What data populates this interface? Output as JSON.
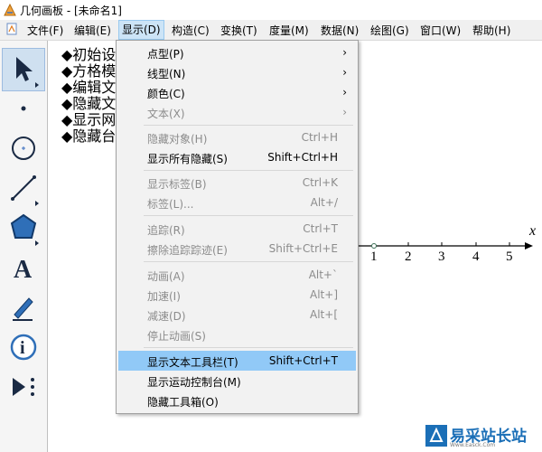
{
  "window": {
    "title": "几何画板 - [未命名1]"
  },
  "menubar": {
    "items": [
      {
        "label": "文件(F)"
      },
      {
        "label": "编辑(E)"
      },
      {
        "label": "显示(D)"
      },
      {
        "label": "构造(C)"
      },
      {
        "label": "变换(T)"
      },
      {
        "label": "度量(M)"
      },
      {
        "label": "数据(N)"
      },
      {
        "label": "绘图(G)"
      },
      {
        "label": "窗口(W)"
      },
      {
        "label": "帮助(H)"
      }
    ]
  },
  "toolbox": {
    "tools": [
      {
        "icon": "arrow-select-icon"
      },
      {
        "icon": "point-icon"
      },
      {
        "icon": "compass-circle-icon"
      },
      {
        "icon": "straightedge-icon"
      },
      {
        "icon": "polygon-icon"
      },
      {
        "icon": "text-tool-icon",
        "glyph": "A"
      },
      {
        "icon": "marker-pen-icon"
      },
      {
        "icon": "information-icon",
        "glyph": "i"
      },
      {
        "icon": "custom-tool-icon"
      }
    ]
  },
  "canvas": {
    "text_lines": [
      "◆初始设",
      "◆方格模",
      "◆编辑文",
      "◆隐藏文",
      "◆显示网",
      "◆隐藏台"
    ],
    "axis": {
      "label": "x",
      "ticks": [
        "1",
        "2",
        "3",
        "4",
        "5"
      ]
    }
  },
  "display_menu": {
    "items": [
      {
        "label": "点型(P)",
        "submenu": true
      },
      {
        "label": "线型(N)",
        "submenu": true
      },
      {
        "label": "颜色(C)",
        "submenu": true
      },
      {
        "label": "文本(X)",
        "submenu": true,
        "disabled": true
      },
      {
        "label": "隐藏对象(H)",
        "shortcut": "Ctrl+H",
        "disabled": true
      },
      {
        "label": "显示所有隐藏(S)",
        "shortcut": "Shift+Ctrl+H"
      },
      {
        "label": "显示标签(B)",
        "shortcut": "Ctrl+K",
        "disabled": true
      },
      {
        "label": "标签(L)...",
        "shortcut": "Alt+/",
        "disabled": true
      },
      {
        "label": "追踪(R)",
        "shortcut": "Ctrl+T",
        "disabled": true
      },
      {
        "label": "擦除追踪踪迹(E)",
        "shortcut": "Shift+Ctrl+E",
        "disabled": true
      },
      {
        "label": "动画(A)",
        "shortcut": "Alt+`",
        "disabled": true
      },
      {
        "label": "加速(I)",
        "shortcut": "Alt+]",
        "disabled": true
      },
      {
        "label": "减速(D)",
        "shortcut": "Alt+[",
        "disabled": true
      },
      {
        "label": "停止动画(S)",
        "disabled": true
      },
      {
        "label": "显示文本工具栏(T)",
        "shortcut": "Shift+Ctrl+T",
        "highlighted": true
      },
      {
        "label": "显示运动控制台(M)"
      },
      {
        "label": "隐藏工具箱(O)"
      }
    ],
    "submenu_arrow": "›"
  },
  "watermark": {
    "text": "易采站长站",
    "sub": "Www.Easck.Com"
  }
}
